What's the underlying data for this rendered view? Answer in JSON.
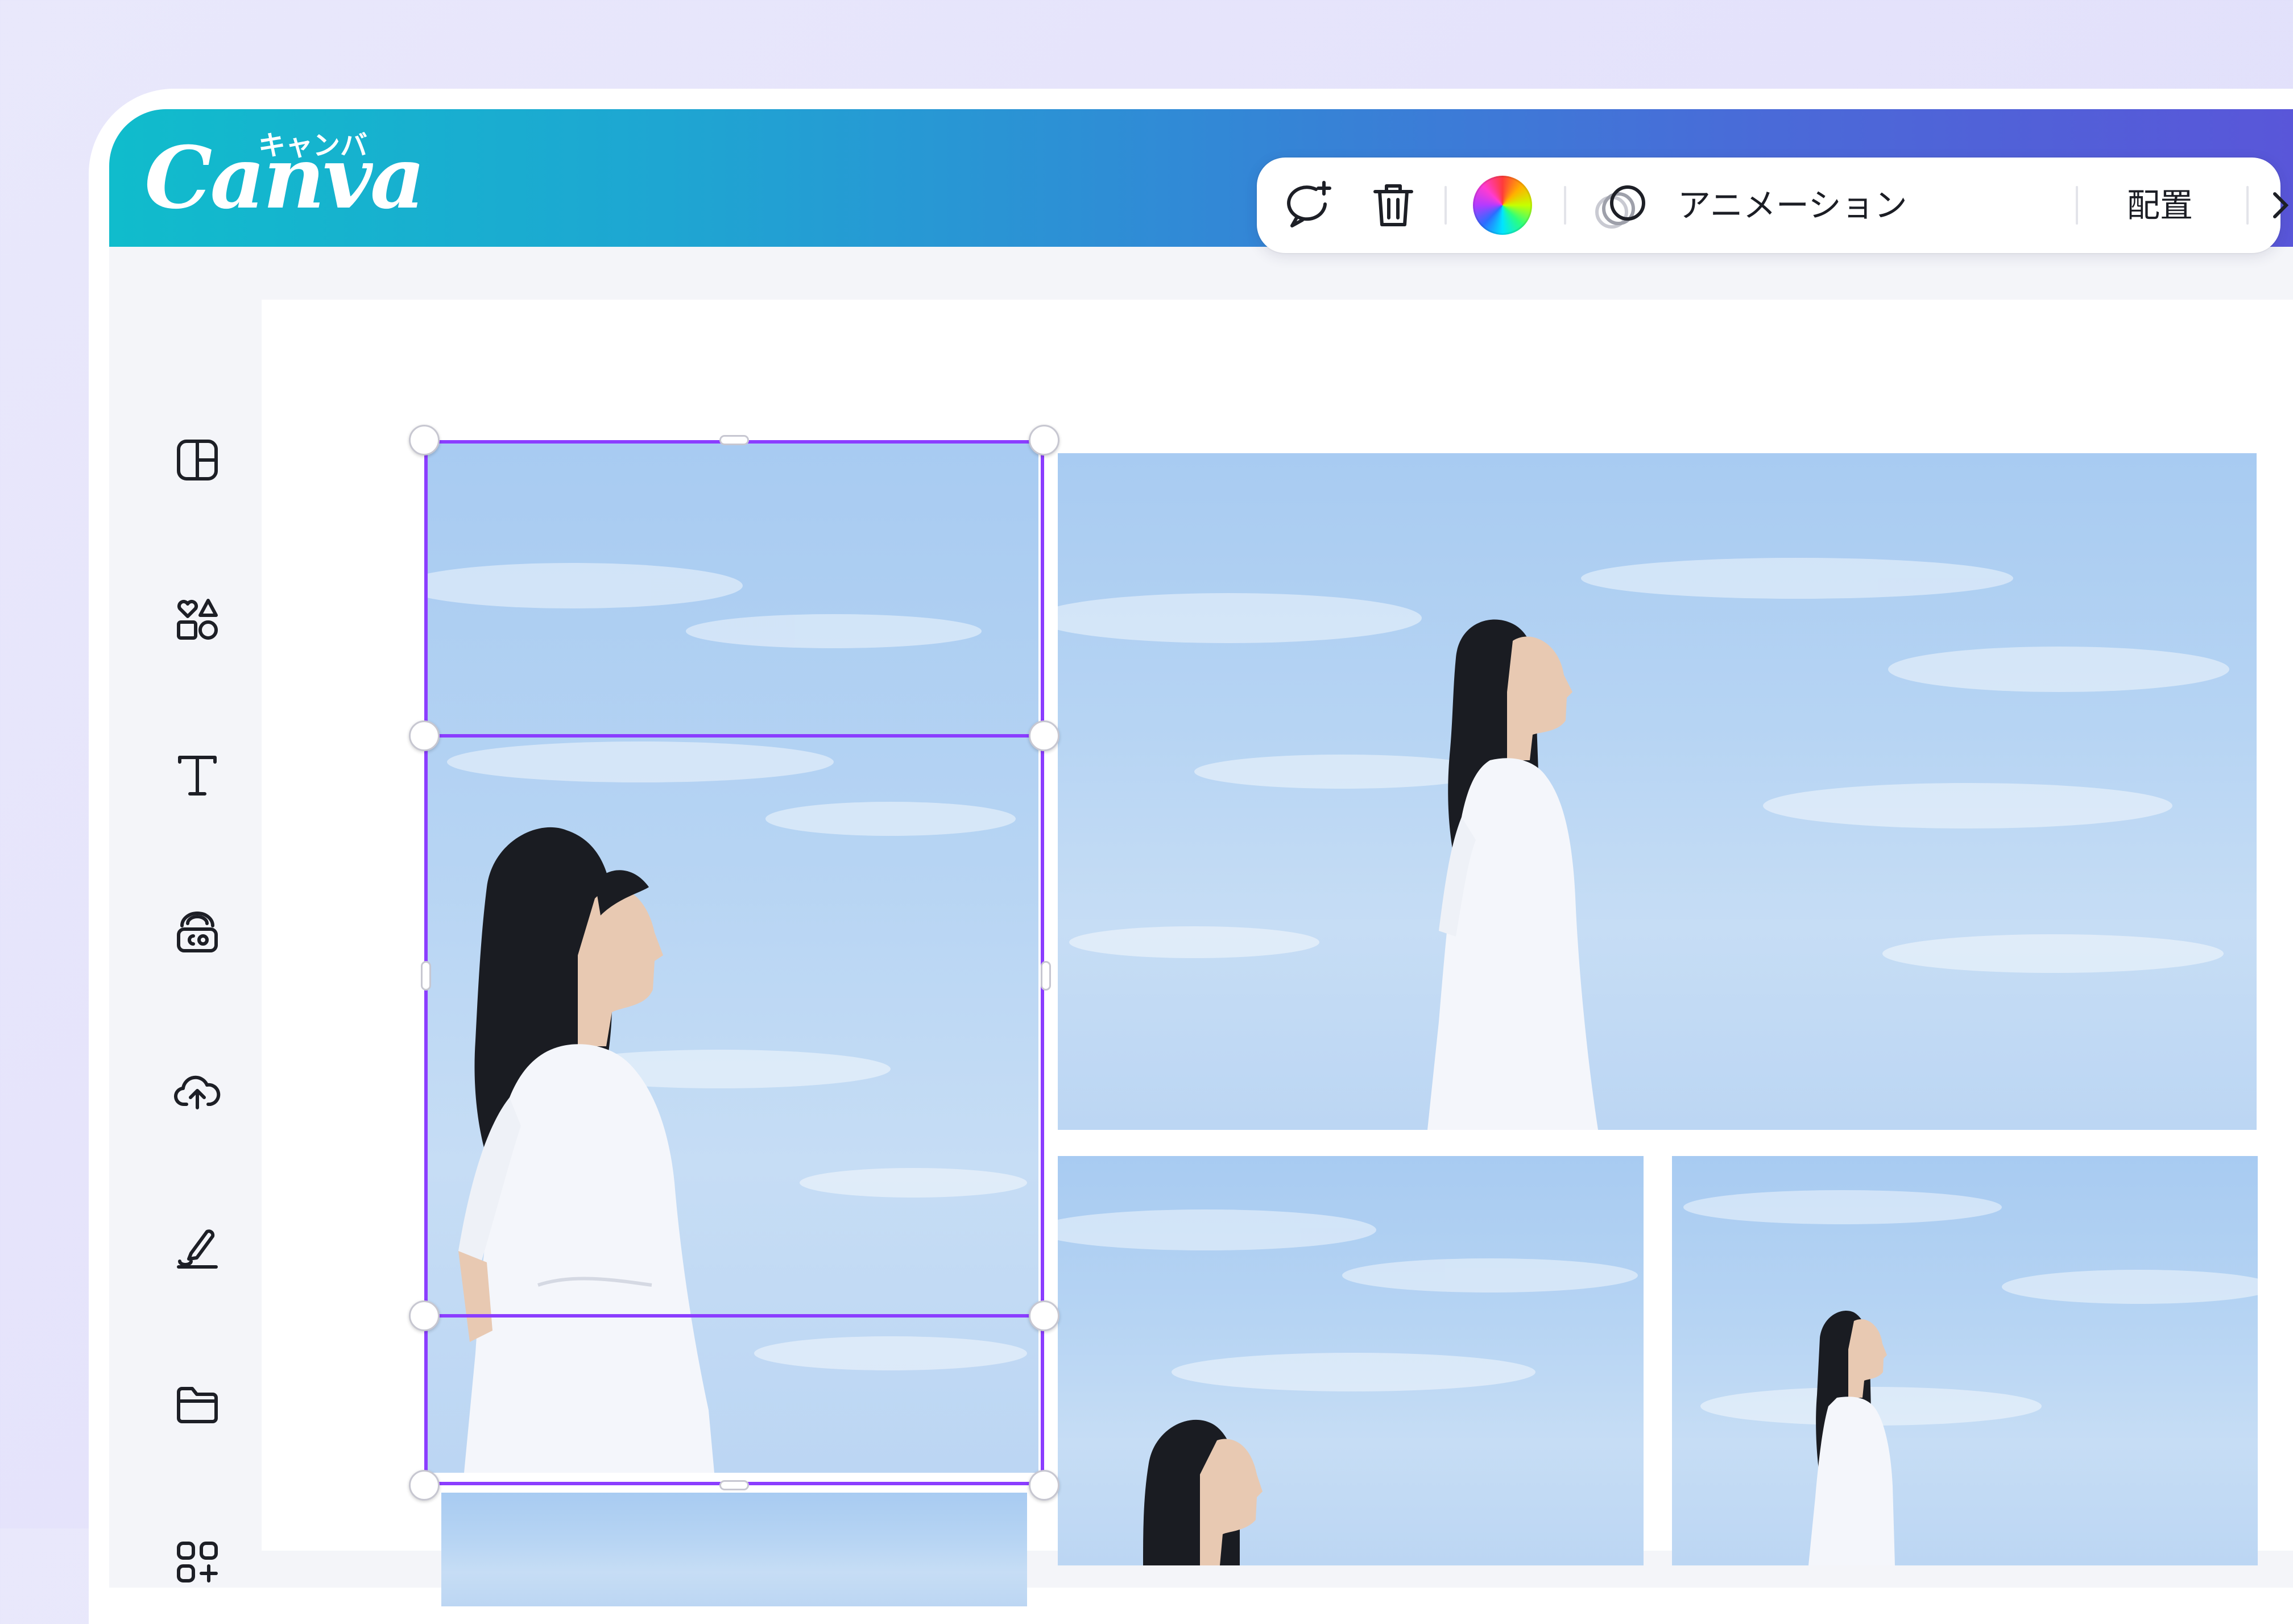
{
  "app": {
    "logo_word": "Canva",
    "logo_kana": "キャンバ"
  },
  "sidebar": {
    "items": [
      {
        "icon": "layout-panel-icon"
      },
      {
        "icon": "elements-shapes-icon"
      },
      {
        "icon": "text-icon"
      },
      {
        "icon": "brand-kit-icon"
      },
      {
        "icon": "upload-cloud-icon"
      },
      {
        "icon": "draw-pen-icon"
      },
      {
        "icon": "folder-icon"
      },
      {
        "icon": "apps-add-icon"
      }
    ]
  },
  "toolbar": {
    "animation_label": "アニメーション",
    "position_label": "配置"
  },
  "colors": {
    "header_start": "#10bccc",
    "header_end": "#5a55d9",
    "selection": "#8b3dff"
  }
}
